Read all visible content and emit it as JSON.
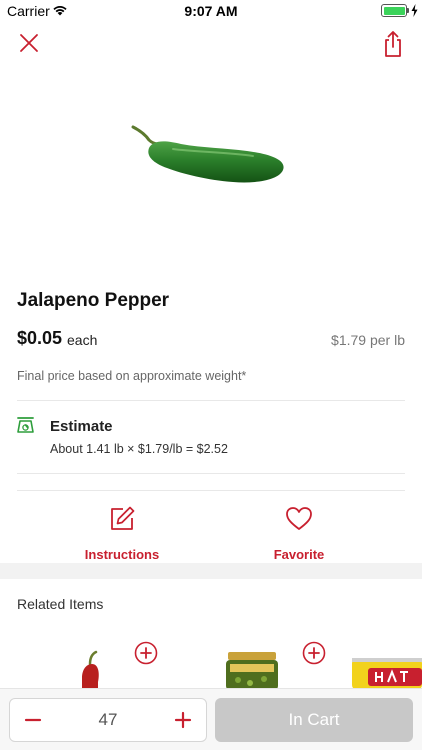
{
  "status_bar": {
    "carrier": "Carrier",
    "time": "9:07 AM"
  },
  "product": {
    "name": "Jalapeno Pepper",
    "price": "$0.05",
    "price_unit": "each",
    "price_per_lb": "$1.79 per lb",
    "note": "Final price based on approximate weight*"
  },
  "estimate": {
    "title": "Estimate",
    "calculation": "About 1.41 lb × $1.79/lb = $2.52"
  },
  "actions": {
    "instructions_label": "Instructions",
    "favorite_label": "Favorite"
  },
  "related": {
    "title": "Related Items"
  },
  "cart": {
    "quantity": "47",
    "in_cart_label": "In Cart"
  },
  "colors": {
    "accent": "#c8202f",
    "estimate_green": "#2e9e3c",
    "disabled_button": "#c8c8c8"
  },
  "icons": [
    "close-icon",
    "share-icon",
    "scale-icon",
    "edit-icon",
    "heart-icon",
    "plus-circle-icon",
    "minus-icon",
    "plus-icon"
  ]
}
